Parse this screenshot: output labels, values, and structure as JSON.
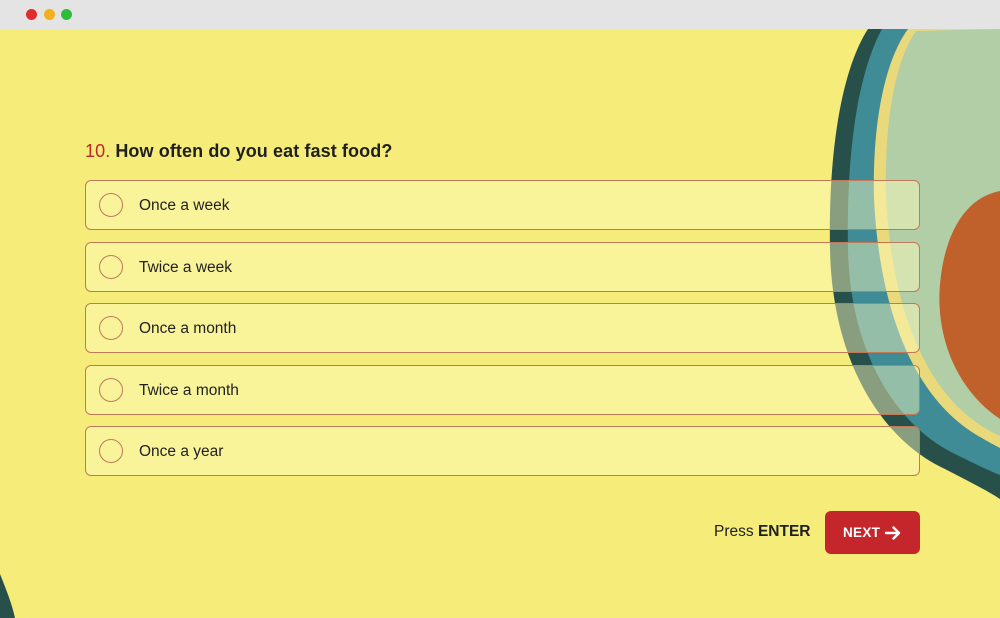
{
  "window": {
    "controls": [
      "close",
      "minimize",
      "maximize"
    ]
  },
  "question": {
    "number": "10.",
    "text": "How often do you eat fast food?"
  },
  "options": [
    {
      "label": "Once a week"
    },
    {
      "label": "Twice a week"
    },
    {
      "label": "Once a month"
    },
    {
      "label": "Twice a month"
    },
    {
      "label": "Once a year"
    }
  ],
  "footer": {
    "press_prefix": "Press",
    "press_key": "ENTER",
    "next_label": "NEXT",
    "next_icon": "arrow-right-icon"
  },
  "colors": {
    "background": "#f5ec7a",
    "accent": "#c5262b",
    "option_border": "#c07a5a"
  }
}
